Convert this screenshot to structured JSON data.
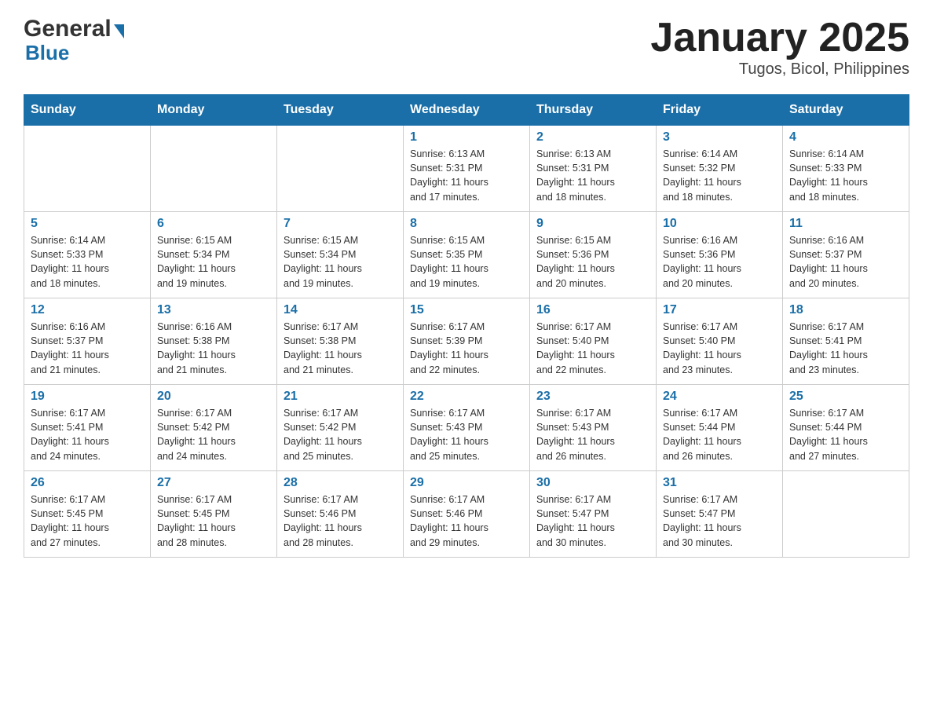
{
  "header": {
    "logo_general": "General",
    "logo_blue": "Blue",
    "title": "January 2025",
    "subtitle": "Tugos, Bicol, Philippines"
  },
  "calendar": {
    "days_of_week": [
      "Sunday",
      "Monday",
      "Tuesday",
      "Wednesday",
      "Thursday",
      "Friday",
      "Saturday"
    ],
    "weeks": [
      [
        {
          "day": "",
          "info": ""
        },
        {
          "day": "",
          "info": ""
        },
        {
          "day": "",
          "info": ""
        },
        {
          "day": "1",
          "info": "Sunrise: 6:13 AM\nSunset: 5:31 PM\nDaylight: 11 hours\nand 17 minutes."
        },
        {
          "day": "2",
          "info": "Sunrise: 6:13 AM\nSunset: 5:31 PM\nDaylight: 11 hours\nand 18 minutes."
        },
        {
          "day": "3",
          "info": "Sunrise: 6:14 AM\nSunset: 5:32 PM\nDaylight: 11 hours\nand 18 minutes."
        },
        {
          "day": "4",
          "info": "Sunrise: 6:14 AM\nSunset: 5:33 PM\nDaylight: 11 hours\nand 18 minutes."
        }
      ],
      [
        {
          "day": "5",
          "info": "Sunrise: 6:14 AM\nSunset: 5:33 PM\nDaylight: 11 hours\nand 18 minutes."
        },
        {
          "day": "6",
          "info": "Sunrise: 6:15 AM\nSunset: 5:34 PM\nDaylight: 11 hours\nand 19 minutes."
        },
        {
          "day": "7",
          "info": "Sunrise: 6:15 AM\nSunset: 5:34 PM\nDaylight: 11 hours\nand 19 minutes."
        },
        {
          "day": "8",
          "info": "Sunrise: 6:15 AM\nSunset: 5:35 PM\nDaylight: 11 hours\nand 19 minutes."
        },
        {
          "day": "9",
          "info": "Sunrise: 6:15 AM\nSunset: 5:36 PM\nDaylight: 11 hours\nand 20 minutes."
        },
        {
          "day": "10",
          "info": "Sunrise: 6:16 AM\nSunset: 5:36 PM\nDaylight: 11 hours\nand 20 minutes."
        },
        {
          "day": "11",
          "info": "Sunrise: 6:16 AM\nSunset: 5:37 PM\nDaylight: 11 hours\nand 20 minutes."
        }
      ],
      [
        {
          "day": "12",
          "info": "Sunrise: 6:16 AM\nSunset: 5:37 PM\nDaylight: 11 hours\nand 21 minutes."
        },
        {
          "day": "13",
          "info": "Sunrise: 6:16 AM\nSunset: 5:38 PM\nDaylight: 11 hours\nand 21 minutes."
        },
        {
          "day": "14",
          "info": "Sunrise: 6:17 AM\nSunset: 5:38 PM\nDaylight: 11 hours\nand 21 minutes."
        },
        {
          "day": "15",
          "info": "Sunrise: 6:17 AM\nSunset: 5:39 PM\nDaylight: 11 hours\nand 22 minutes."
        },
        {
          "day": "16",
          "info": "Sunrise: 6:17 AM\nSunset: 5:40 PM\nDaylight: 11 hours\nand 22 minutes."
        },
        {
          "day": "17",
          "info": "Sunrise: 6:17 AM\nSunset: 5:40 PM\nDaylight: 11 hours\nand 23 minutes."
        },
        {
          "day": "18",
          "info": "Sunrise: 6:17 AM\nSunset: 5:41 PM\nDaylight: 11 hours\nand 23 minutes."
        }
      ],
      [
        {
          "day": "19",
          "info": "Sunrise: 6:17 AM\nSunset: 5:41 PM\nDaylight: 11 hours\nand 24 minutes."
        },
        {
          "day": "20",
          "info": "Sunrise: 6:17 AM\nSunset: 5:42 PM\nDaylight: 11 hours\nand 24 minutes."
        },
        {
          "day": "21",
          "info": "Sunrise: 6:17 AM\nSunset: 5:42 PM\nDaylight: 11 hours\nand 25 minutes."
        },
        {
          "day": "22",
          "info": "Sunrise: 6:17 AM\nSunset: 5:43 PM\nDaylight: 11 hours\nand 25 minutes."
        },
        {
          "day": "23",
          "info": "Sunrise: 6:17 AM\nSunset: 5:43 PM\nDaylight: 11 hours\nand 26 minutes."
        },
        {
          "day": "24",
          "info": "Sunrise: 6:17 AM\nSunset: 5:44 PM\nDaylight: 11 hours\nand 26 minutes."
        },
        {
          "day": "25",
          "info": "Sunrise: 6:17 AM\nSunset: 5:44 PM\nDaylight: 11 hours\nand 27 minutes."
        }
      ],
      [
        {
          "day": "26",
          "info": "Sunrise: 6:17 AM\nSunset: 5:45 PM\nDaylight: 11 hours\nand 27 minutes."
        },
        {
          "day": "27",
          "info": "Sunrise: 6:17 AM\nSunset: 5:45 PM\nDaylight: 11 hours\nand 28 minutes."
        },
        {
          "day": "28",
          "info": "Sunrise: 6:17 AM\nSunset: 5:46 PM\nDaylight: 11 hours\nand 28 minutes."
        },
        {
          "day": "29",
          "info": "Sunrise: 6:17 AM\nSunset: 5:46 PM\nDaylight: 11 hours\nand 29 minutes."
        },
        {
          "day": "30",
          "info": "Sunrise: 6:17 AM\nSunset: 5:47 PM\nDaylight: 11 hours\nand 30 minutes."
        },
        {
          "day": "31",
          "info": "Sunrise: 6:17 AM\nSunset: 5:47 PM\nDaylight: 11 hours\nand 30 minutes."
        },
        {
          "day": "",
          "info": ""
        }
      ]
    ]
  }
}
